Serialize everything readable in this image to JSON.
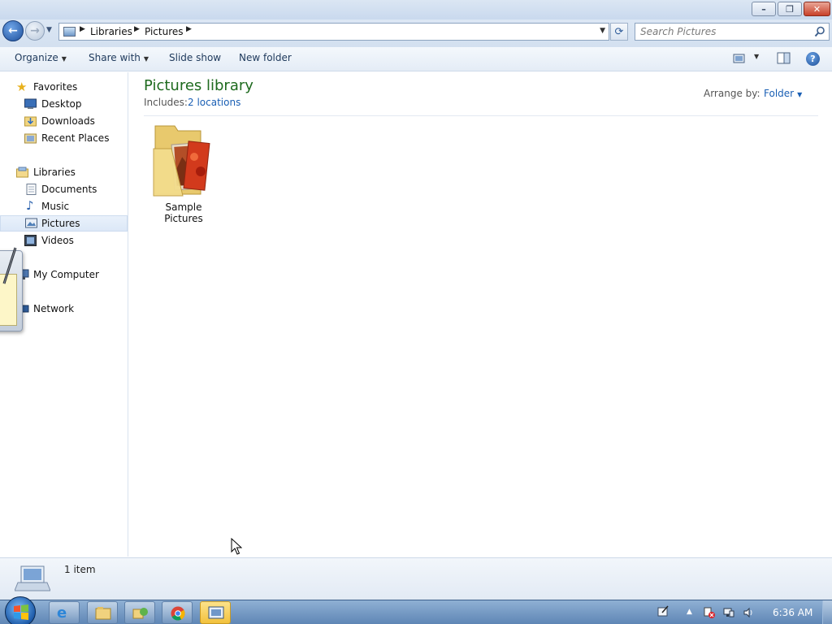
{
  "window": {
    "minimize_glyph": "–",
    "maximize_glyph": "❐",
    "close_glyph": "✕"
  },
  "address_bar": {
    "breadcrumbs": [
      "Libraries",
      "Pictures"
    ],
    "search_placeholder": "Search Pictures"
  },
  "toolbar": {
    "organize": "Organize",
    "share_with": "Share with",
    "slide_show": "Slide show",
    "new_folder": "New folder",
    "help_glyph": "?"
  },
  "nav_pane": {
    "favorites": {
      "label": "Favorites",
      "items": [
        "Desktop",
        "Downloads",
        "Recent Places"
      ]
    },
    "libraries": {
      "label": "Libraries",
      "items": [
        "Documents",
        "Music",
        "Pictures",
        "Videos"
      ],
      "selected": "Pictures"
    },
    "computer": "My Computer",
    "network": "Network"
  },
  "content": {
    "title": "Pictures library",
    "includes_label": "Includes:",
    "includes_link": "2 locations",
    "arrange_label": "Arrange by:",
    "arrange_value": "Folder",
    "items": [
      {
        "label": "Sample Pictures",
        "icon": "folder-pictures-icon"
      }
    ]
  },
  "details": {
    "item_count": "1 item"
  },
  "taskbar": {
    "apps": [
      "internet-explorer",
      "windows-explorer",
      "file-transfer",
      "chrome",
      "pictures-explorer"
    ],
    "active_app": "pictures-explorer",
    "clock": "6:36 AM"
  },
  "colors": {
    "library_title": "#1e6a1e",
    "link": "#1a5fb4",
    "taskbar": "#5f86b5"
  }
}
